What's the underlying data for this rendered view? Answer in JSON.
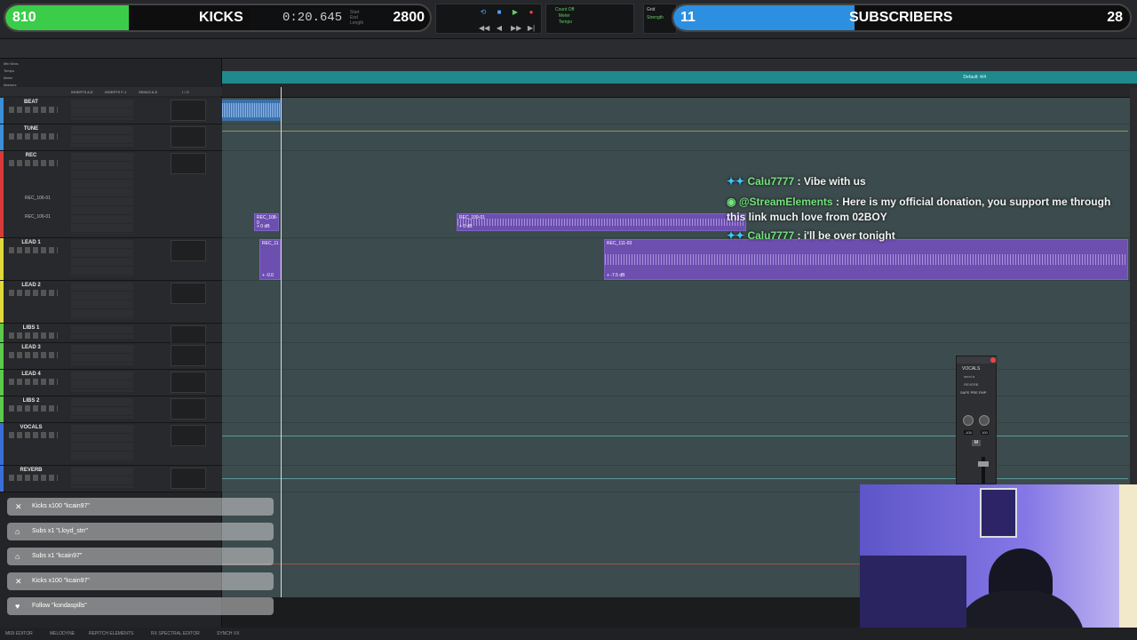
{
  "overlay": {
    "kicks": {
      "count": "810",
      "label": "KICKS",
      "goal": "2800",
      "progress": 0.2893
    },
    "subscribers": {
      "count": "11",
      "label": "SUBSCRIBERS",
      "goal": "28",
      "progress": 0.3929
    }
  },
  "transport": {
    "counter": "0:20.645",
    "labels": {
      "start": "Start",
      "end": "End",
      "length": "Length"
    },
    "count_off": "Count Off",
    "meter": "Meter",
    "tempo": "Tempo",
    "grid": "Grid",
    "strength": "Strength"
  },
  "ruler": {
    "side_labels": [
      "Min:Secs",
      "Tempo",
      "Meter",
      "Markers"
    ],
    "meter_label": "Default: 4/4"
  },
  "column_headers": [
    "INSERTS A-E",
    "INSERTS F-J",
    "SENDS A-E",
    "I / O"
  ],
  "tracks": [
    {
      "name": "BEAT",
      "color": "#3a8fd8"
    },
    {
      "name": "TUNE",
      "color": "#3a8fd8"
    },
    {
      "name": "REC",
      "color": "#d83a3a"
    },
    {
      "name": "LEAD 1",
      "color": "#e0d93a"
    },
    {
      "name": "LEAD 2",
      "color": "#e0d93a"
    },
    {
      "name": "LIBS 1",
      "color": "#5bc94a"
    },
    {
      "name": "LEAD 3",
      "color": "#5bc94a"
    },
    {
      "name": "LEAD 4",
      "color": "#5bc94a"
    },
    {
      "name": "LIBS 2",
      "color": "#5bc94a"
    },
    {
      "name": "VOCALS",
      "color": "#3a6fd8"
    },
    {
      "name": "REVERB",
      "color": "#3a6fd8"
    }
  ],
  "playlists": [
    "REC_106-01",
    "REC_106-01"
  ],
  "clips": [
    {
      "name": "REC_108-0",
      "gain": "+ 0 dB"
    },
    {
      "name": "REC_109-01",
      "gain": "+ 0 dB"
    },
    {
      "name": "REC_11",
      "gain": "+ -0.0"
    },
    {
      "name": "REC_111-03",
      "gain": "+ -7.5 dB"
    }
  ],
  "chat": [
    {
      "user": "Calu7777",
      "text": ": Vibe with us"
    },
    {
      "user": "@StreamElements",
      "text": ": Here is my official donation, you support me through this link much love from 02BOY"
    },
    {
      "user": "Calu7777",
      "text": ":    i'll be over tonight"
    }
  ],
  "notifications": [
    {
      "icon": "x",
      "text": "Kicks x100 \"kcain97\""
    },
    {
      "icon": "gift",
      "text": "Subs x1 \"Lloyd_strr\""
    },
    {
      "icon": "gift",
      "text": "Subs x1 \"kcain97\""
    },
    {
      "icon": "x",
      "text": "Kicks x100 \"kcain97\""
    },
    {
      "icon": "heart",
      "text": "Follow \"kondaspills\""
    }
  ],
  "plugin_window": {
    "track": "VOCALS",
    "send": "send a",
    "name": "REVERB",
    "safe": "SAFE",
    "pre": "PRE",
    "fmp": "FMP",
    "pan_l": "-100",
    "pan_r": "100",
    "mute": "M"
  },
  "bottom_tabs": [
    "MIDI EDITOR",
    "MELODYNE",
    "REPITCH ELEMENTS",
    "RX SPECTRAL EDITOR",
    "SYNCH VX"
  ],
  "colors": {
    "kicks_fill": "#3bcc4a",
    "subs_fill": "#2c8fe0",
    "clip": "#6d4fb0",
    "tempo_ruler": "#1f8a8d",
    "edit_bg": "#3c4b4d"
  }
}
